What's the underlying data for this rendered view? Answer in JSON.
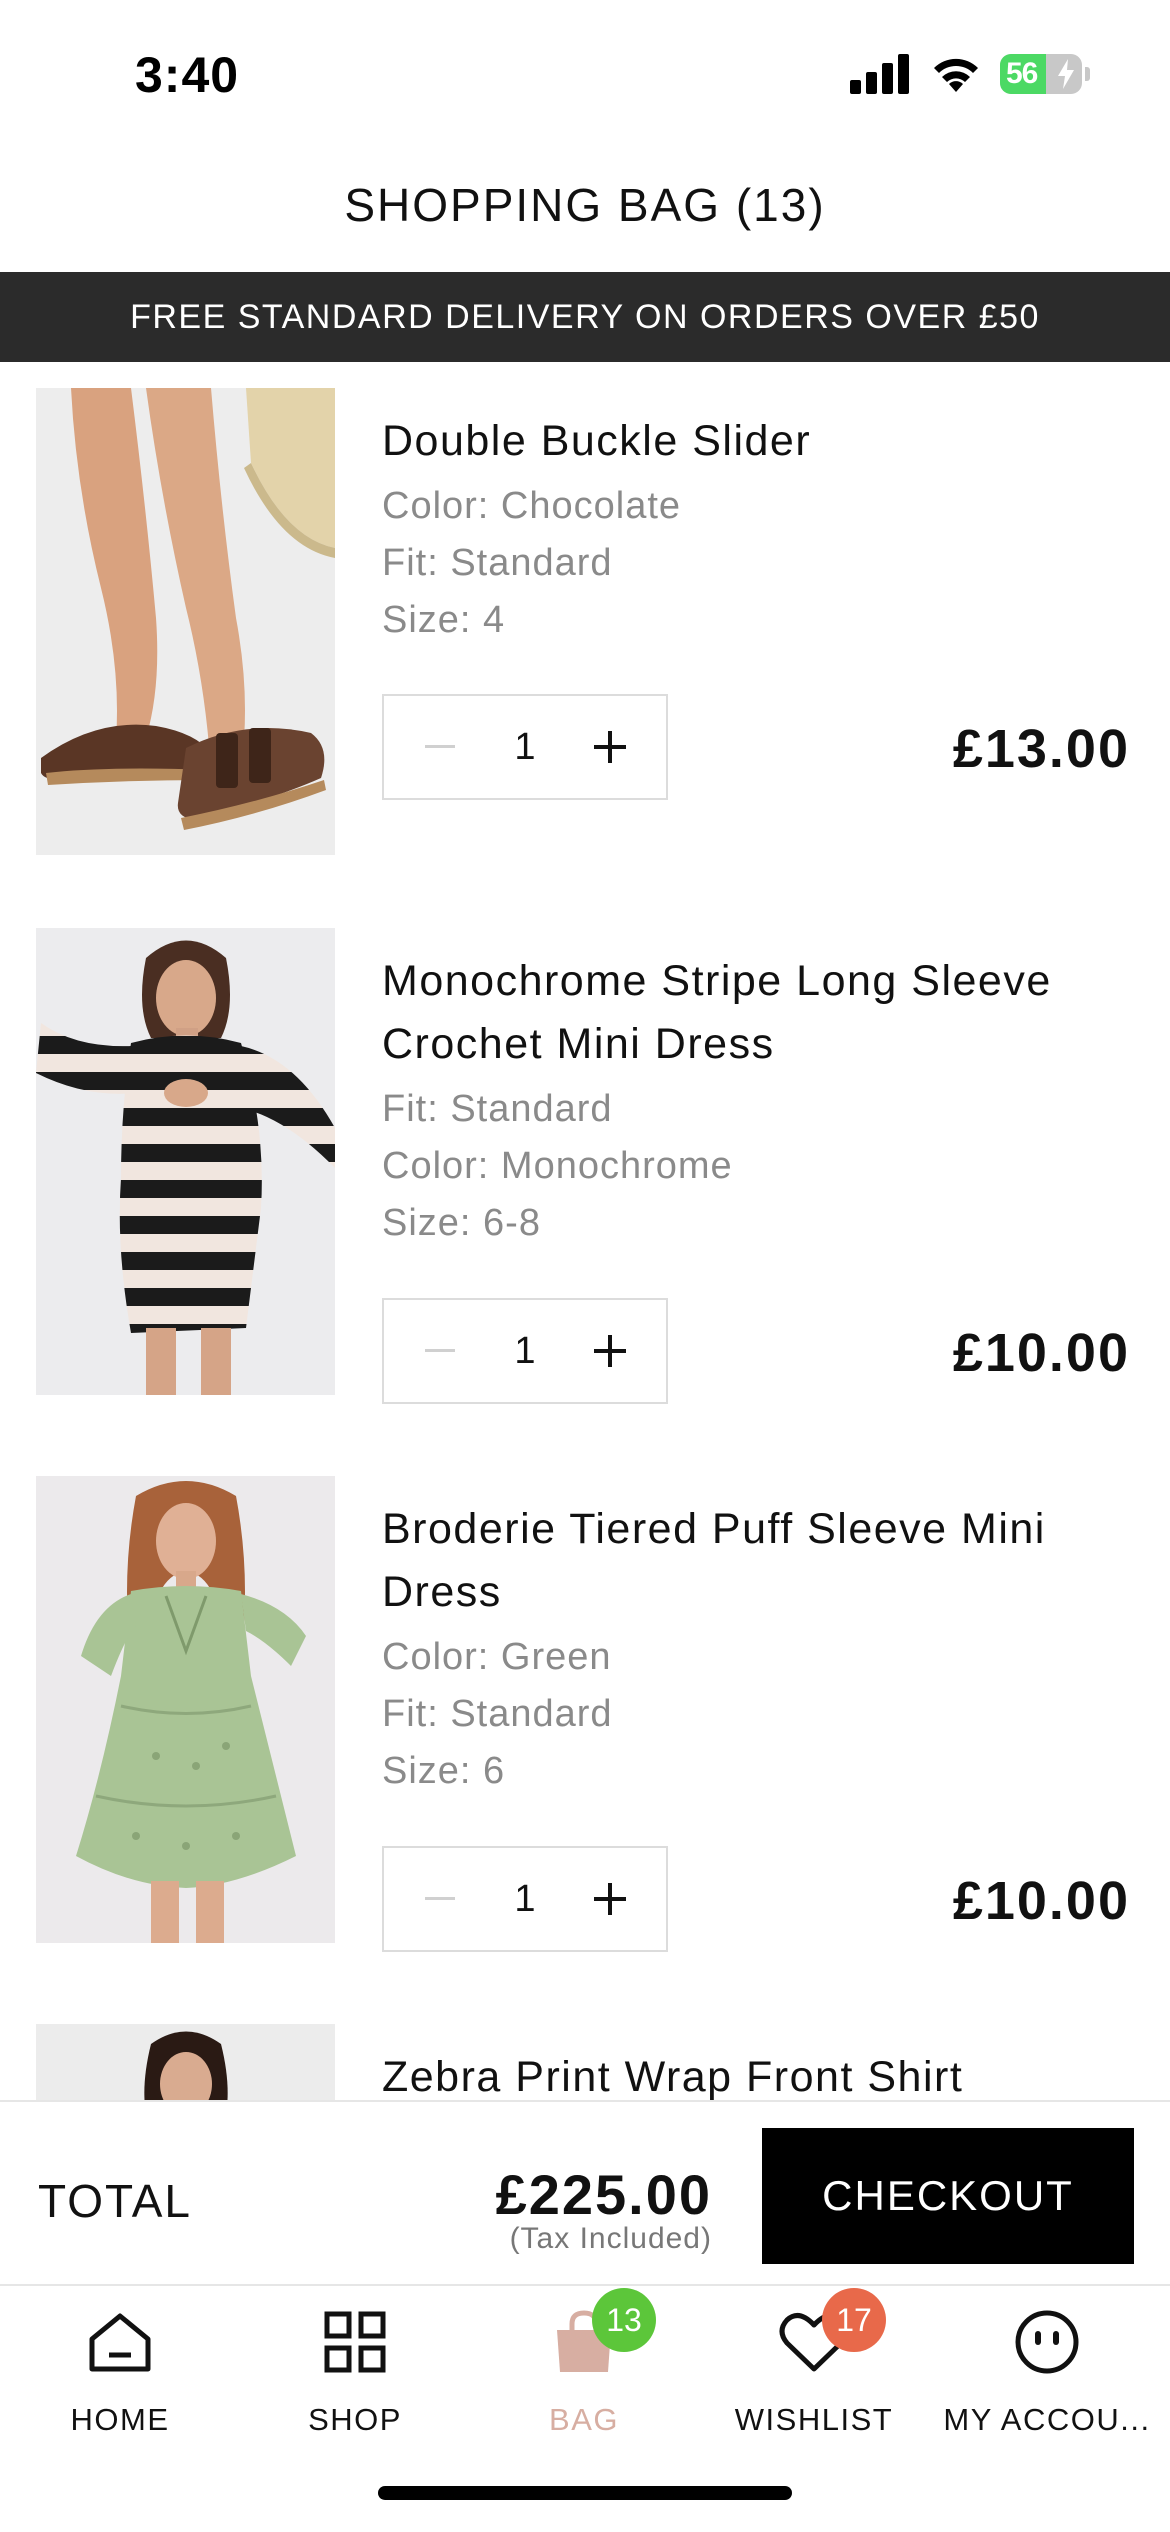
{
  "status_bar": {
    "time": "3:40",
    "battery": "56"
  },
  "header": {
    "title": "SHOPPING BAG (13)",
    "banner": "FREE STANDARD DELIVERY ON ORDERS OVER £50"
  },
  "items": [
    {
      "name": "Double Buckle Slider",
      "attrs": [
        "Color: Chocolate",
        "Fit: Standard",
        "Size: 4"
      ],
      "quantity": "1",
      "price": "£13.00",
      "image": "brown-double-buckle-sandals"
    },
    {
      "name": "Monochrome Stripe Long Sleeve Crochet Mini Dress",
      "attrs": [
        "Fit: Standard",
        "Color: Monochrome",
        "Size: 6-8"
      ],
      "quantity": "1",
      "price": "£10.00",
      "image": "black-white-striped-crochet-dress"
    },
    {
      "name": "Broderie Tiered Puff Sleeve Mini Dress",
      "attrs": [
        "Color: Green",
        "Fit: Standard",
        "Size: 6"
      ],
      "quantity": "1",
      "price": "£10.00",
      "image": "green-broderie-dress"
    },
    {
      "name": "Zebra Print Wrap Front Shirt",
      "image": "zebra-print-shirt"
    }
  ],
  "summary": {
    "total_label": "TOTAL",
    "total_amount": "£225.00",
    "tax_note": "(Tax Included)",
    "checkout_label": "CHECKOUT"
  },
  "tabs": [
    {
      "label": "HOME",
      "icon": "home-icon"
    },
    {
      "label": "SHOP",
      "icon": "grid-icon"
    },
    {
      "label": "BAG",
      "icon": "bag-icon",
      "badge": "13",
      "active": true
    },
    {
      "label": "WISHLIST",
      "icon": "heart-icon",
      "badge": "17"
    },
    {
      "label": "MY ACCOU...",
      "icon": "account-icon"
    }
  ],
  "colors": {
    "banner_bg": "#2b2b2b",
    "active_tab": "#d7aea2",
    "bag_badge": "#5cc63a",
    "wishlist_badge": "#e8694a",
    "checkout_bg": "#000000"
  }
}
